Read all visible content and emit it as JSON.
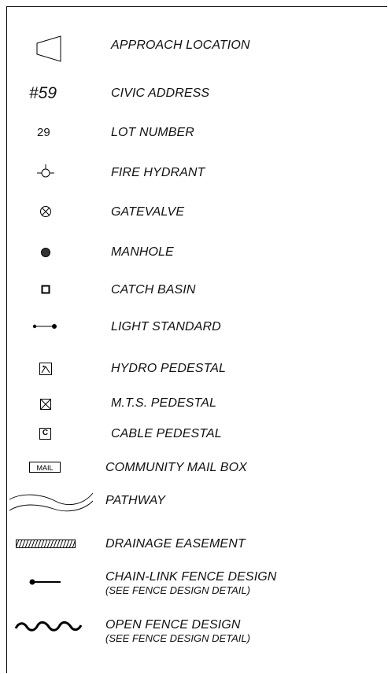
{
  "legend": {
    "items": [
      {
        "label": "APPROACH LOCATION",
        "icon": "approach-location-icon"
      },
      {
        "label": "CIVIC ADDRESS",
        "symbol_text": "#59"
      },
      {
        "label": "LOT NUMBER",
        "symbol_text": "29"
      },
      {
        "label": "FIRE HYDRANT",
        "icon": "fire-hydrant-icon"
      },
      {
        "label": "GATEVALVE",
        "icon": "gatevalve-icon"
      },
      {
        "label": "MANHOLE",
        "icon": "manhole-icon"
      },
      {
        "label": "CATCH BASIN",
        "icon": "catch-basin-icon"
      },
      {
        "label": "LIGHT STANDARD",
        "icon": "light-standard-icon"
      },
      {
        "label": "HYDRO PEDESTAL",
        "icon": "hydro-pedestal-icon"
      },
      {
        "label": "M.T.S. PEDESTAL",
        "icon": "mts-pedestal-icon"
      },
      {
        "label": "CABLE PEDESTAL",
        "icon": "cable-pedestal-icon",
        "symbol_text": "C"
      },
      {
        "label": "COMMUNITY MAIL BOX",
        "icon": "mail-box-icon",
        "symbol_text": "MAIL"
      },
      {
        "label": "PATHWAY",
        "icon": "pathway-icon"
      },
      {
        "label": "DRAINAGE EASEMENT",
        "icon": "drainage-easement-icon"
      },
      {
        "label": "CHAIN-LINK FENCE DESIGN",
        "sublabel": "(SEE FENCE DESIGN DETAIL)",
        "icon": "chain-link-fence-icon"
      },
      {
        "label": "OPEN FENCE DESIGN",
        "sublabel": "(SEE FENCE DESIGN DETAIL)",
        "icon": "open-fence-icon"
      }
    ]
  }
}
